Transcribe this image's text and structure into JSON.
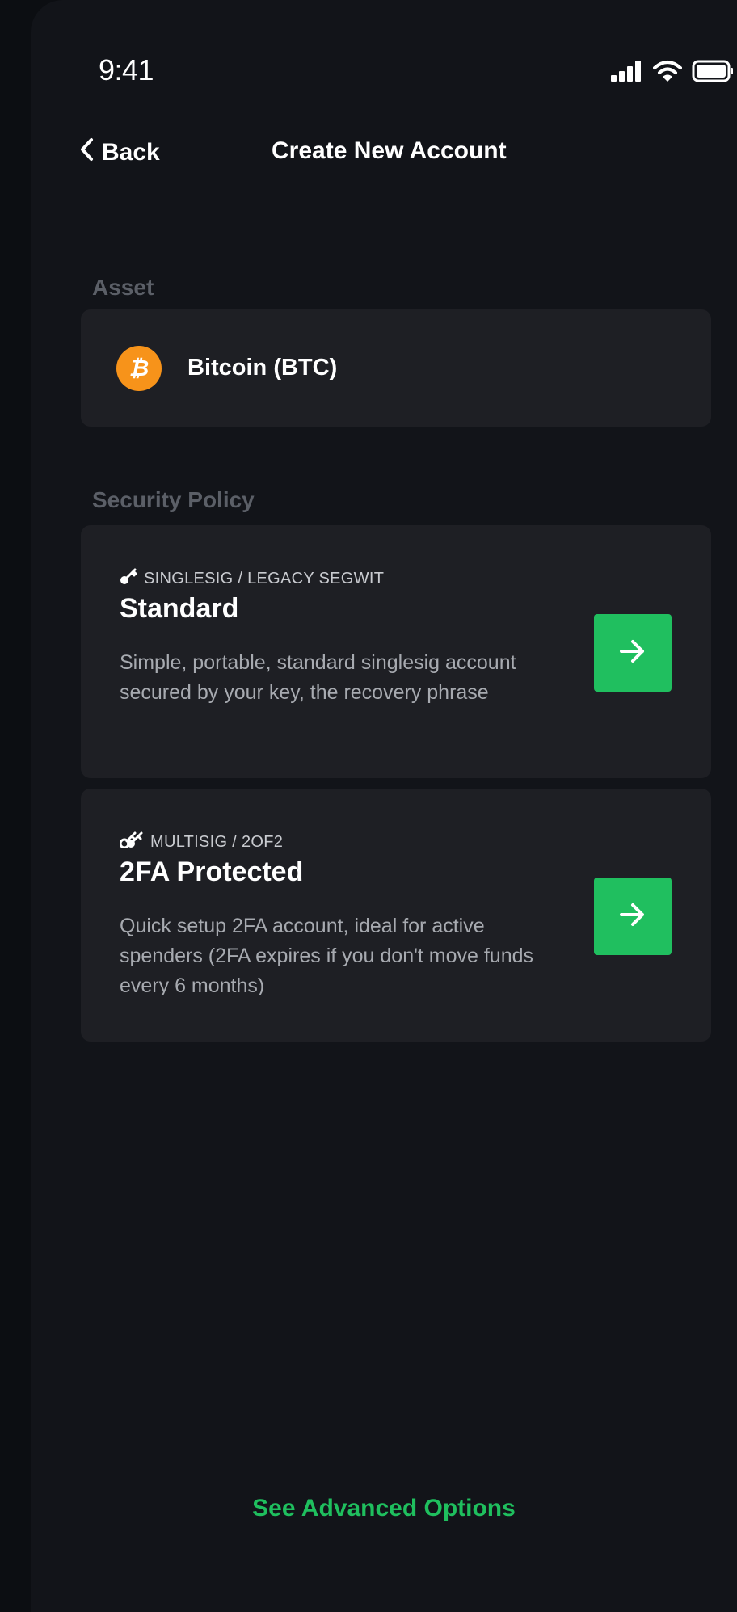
{
  "status_bar": {
    "time": "9:41",
    "icons": [
      "cellular-signal-icon",
      "wifi-icon",
      "battery-icon"
    ]
  },
  "nav": {
    "back_label": "Back",
    "title": "Create New Account"
  },
  "asset": {
    "section_label": "Asset",
    "coin_symbol": "₿",
    "name": "Bitcoin (BTC)",
    "coin_color": "#f7931a"
  },
  "security_policy": {
    "section_label": "Security Policy",
    "options": [
      {
        "tag": "SINGLESIG / LEGACY SEGWIT",
        "tag_icon": "key-icon",
        "title": "Standard",
        "description": "Simple, portable, standard singlesig account secured by your key, the recovery phrase"
      },
      {
        "tag": "MULTISIG / 2OF2",
        "tag_icon": "keys-icon",
        "title": "2FA Protected",
        "description": "Quick setup 2FA account, ideal for active spenders (2FA expires if you don't move funds every 6 months)"
      }
    ]
  },
  "advanced_link": "See Advanced Options",
  "colors": {
    "background": "#121419",
    "card": "#1e1f24",
    "accent": "#20bf5f",
    "muted_label": "#5b5f67"
  }
}
